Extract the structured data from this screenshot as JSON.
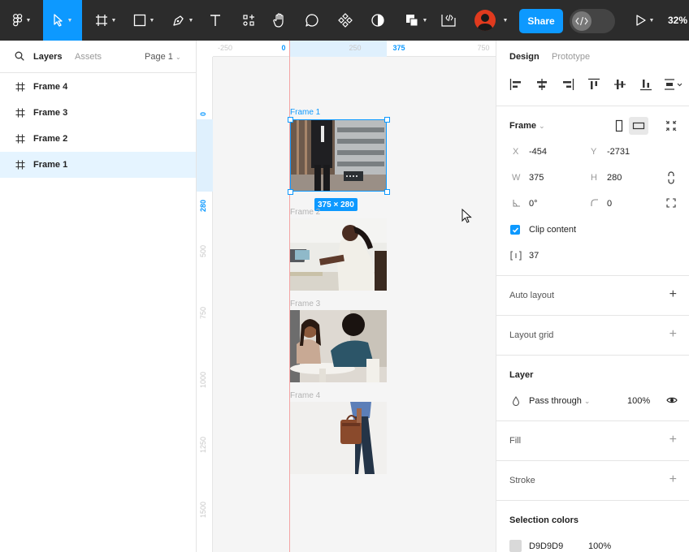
{
  "toolbar": {
    "share_label": "Share",
    "zoom": "32%",
    "colors": {
      "bg": "#2c2c2c",
      "accent": "#0d99ff",
      "avatar": "#e03a1e"
    },
    "icons": [
      "figma-menu-icon",
      "move-icon",
      "frame-icon",
      "rectangle-icon",
      "pen-icon",
      "text-icon",
      "resources-icon",
      "hand-icon",
      "comment-icon",
      "component-icon",
      "mask-icon",
      "boolean-icon",
      "crop-icon",
      "avatar",
      "dev-mode-icon",
      "present-icon"
    ]
  },
  "left": {
    "tabs": {
      "layers": "Layers",
      "assets": "Assets",
      "page": "Page 1"
    },
    "layers": [
      {
        "label": "Frame 4"
      },
      {
        "label": "Frame 3"
      },
      {
        "label": "Frame 2"
      },
      {
        "label": "Frame 1",
        "selected": true
      }
    ]
  },
  "canvas": {
    "ruler_top": [
      "-250",
      "0",
      "250",
      "375",
      "750"
    ],
    "ruler_left": [
      "0",
      "280",
      "500",
      "750",
      "1000",
      "1250",
      "1500"
    ],
    "frames": [
      {
        "title": "Frame 1"
      },
      {
        "title": "Frame 2"
      },
      {
        "title": "Frame 3"
      },
      {
        "title": "Frame 4"
      }
    ],
    "size_badge": "375 × 280"
  },
  "right": {
    "tabs": {
      "design": "Design",
      "prototype": "Prototype"
    },
    "frame": {
      "title": "Frame",
      "x_label": "X",
      "x": "-454",
      "y_label": "Y",
      "y": "-2731",
      "w_label": "W",
      "w": "375",
      "h_label": "H",
      "h": "280",
      "rotation": "0°",
      "radius": "0",
      "clip_label": "Clip content",
      "spacing": "37"
    },
    "auto_layout": "Auto layout",
    "layout_grid": "Layout grid",
    "layer": {
      "title": "Layer",
      "blend": "Pass through",
      "opacity": "100%"
    },
    "fill": "Fill",
    "stroke": "Stroke",
    "selection_colors": {
      "title": "Selection colors",
      "hex": "D9D9D9",
      "opacity": "100%",
      "swatch": "#d9d9d9"
    }
  }
}
